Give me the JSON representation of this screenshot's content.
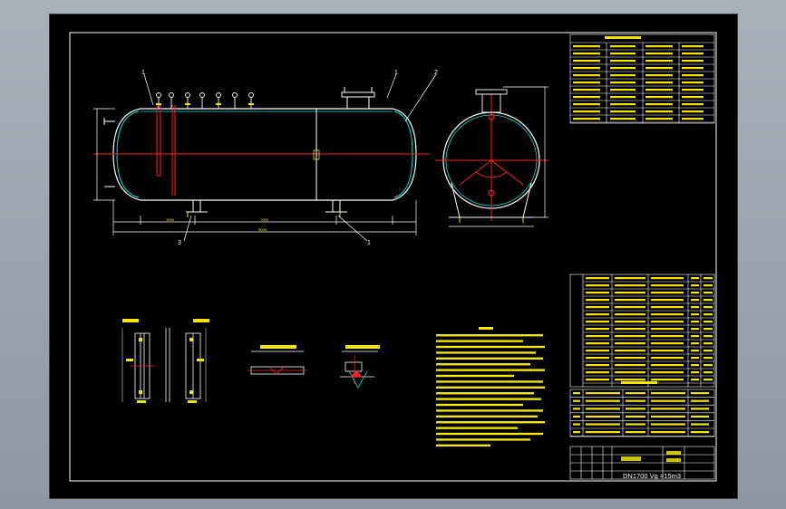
{
  "drawing": {
    "title_block": {
      "main_title": "DN1700 Vg =15m3"
    },
    "callouts": {
      "vessel_top_left": "1",
      "vessel_top_mid": "1",
      "vessel_top_right": "2",
      "support_left": "3",
      "support_right": "1"
    },
    "dimensions": {
      "main_length": "7000",
      "left_offset": "1000",
      "overall_length": "9000"
    }
  }
}
